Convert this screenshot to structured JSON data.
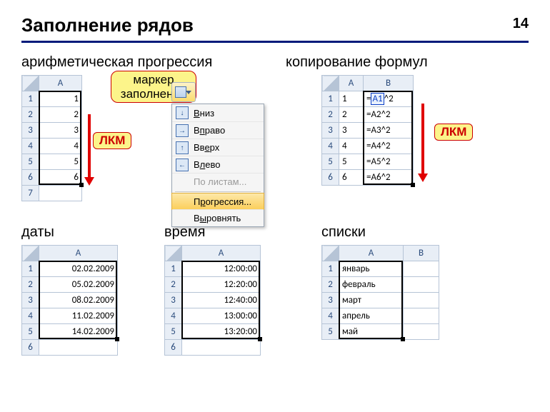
{
  "page_number": "14",
  "title": "Заполнение рядов",
  "sections": {
    "arith": {
      "heading": "арифметическая прогрессия",
      "col": "A",
      "rows": [
        "1",
        "2",
        "3",
        "4",
        "5",
        "6"
      ],
      "empty_row": "7",
      "callout": "маркер заполнения",
      "lkm": "ЛКМ",
      "menu": {
        "down": "Вниз",
        "right": "Вправо",
        "up": "Вверх",
        "left": "Влево",
        "sheets": "По листам...",
        "progression": "Прогрессия...",
        "justify": "Выровнять"
      }
    },
    "formulas": {
      "heading": "копирование формул",
      "cols": [
        "A",
        "B"
      ],
      "rows": [
        {
          "a": "1",
          "b": "=A1^2",
          "ref": "A1"
        },
        {
          "a": "2",
          "b": "=A2^2"
        },
        {
          "a": "3",
          "b": "=A3^2"
        },
        {
          "a": "4",
          "b": "=A4^2"
        },
        {
          "a": "5",
          "b": "=A5^2"
        },
        {
          "a": "6",
          "b": "=A6^2"
        }
      ],
      "lkm": "ЛКМ"
    },
    "dates": {
      "heading": "даты",
      "col": "A",
      "rows": [
        "02.02.2009",
        "05.02.2009",
        "08.02.2009",
        "11.02.2009",
        "14.02.2009"
      ],
      "empty_row": "6"
    },
    "time": {
      "heading": "время",
      "col": "A",
      "rows": [
        "12:00:00",
        "12:20:00",
        "12:40:00",
        "13:00:00",
        "13:20:00"
      ],
      "empty_row": "6"
    },
    "lists": {
      "heading": "списки",
      "cols": [
        "A",
        "B"
      ],
      "rows": [
        "январь",
        "февраль",
        "март",
        "апрель",
        "май"
      ]
    }
  }
}
